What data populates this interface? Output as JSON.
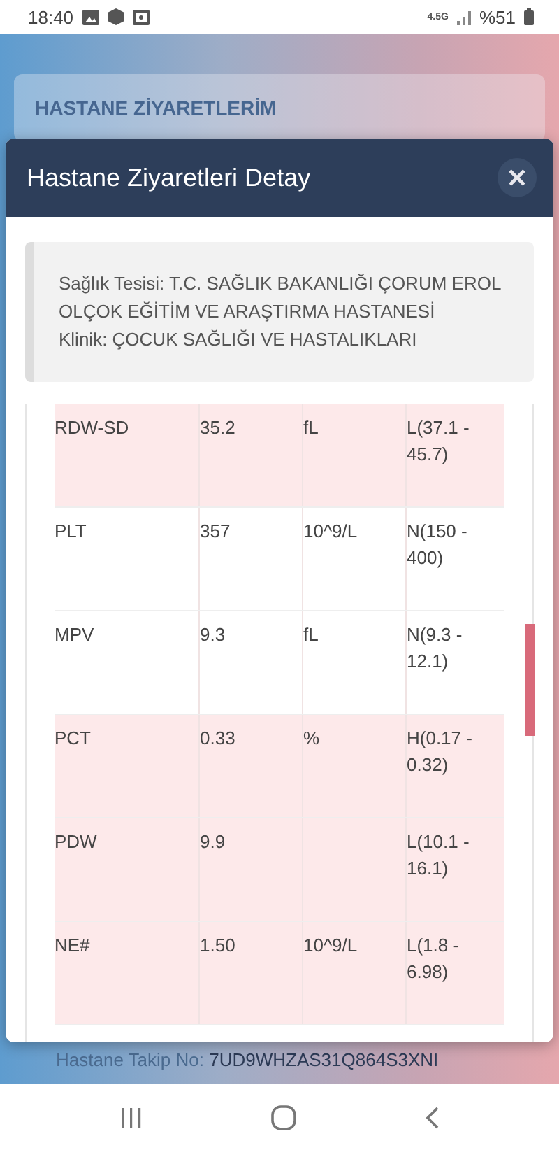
{
  "status_bar": {
    "time": "18:40",
    "network": "4.5G",
    "battery": "%51"
  },
  "page": {
    "card_title": "HASTANE ZİYARETLERİM",
    "tracking_label": "Hastane Takip No:",
    "tracking_value": "7UD9WHZAS31Q864S3XNI"
  },
  "modal": {
    "title": "Hastane Ziyaretleri Detay",
    "info": [
      "Sağlık Tesisi: T.C. SAĞLIK BAKANLIĞI ÇORUM EROL OLÇOK EĞİTİM VE ARAŞTIRMA HASTANESİ",
      "Klinik: ÇOCUK SAĞLIĞI VE HASTALIKLARI"
    ],
    "rows": [
      {
        "test": "RDW-SD",
        "result": "35.2",
        "unit": "fL",
        "range": "L(37.1 - 45.7)",
        "abnormal": true
      },
      {
        "test": "PLT",
        "result": "357",
        "unit": "10^9/L",
        "range": "N(150 - 400)",
        "abnormal": false
      },
      {
        "test": "MPV",
        "result": "9.3",
        "unit": "fL",
        "range": "N(9.3 - 12.1)",
        "abnormal": false
      },
      {
        "test": "PCT",
        "result": "0.33",
        "unit": "%",
        "range": "H(0.17 - 0.32)",
        "abnormal": true
      },
      {
        "test": "PDW",
        "result": "9.9",
        "unit": "",
        "range": "L(10.1 - 16.1)",
        "abnormal": true
      },
      {
        "test": "NE#",
        "result": "1.50",
        "unit": "10^9/L",
        "range": "L(1.8 - 6.98)",
        "abnormal": true
      }
    ]
  }
}
